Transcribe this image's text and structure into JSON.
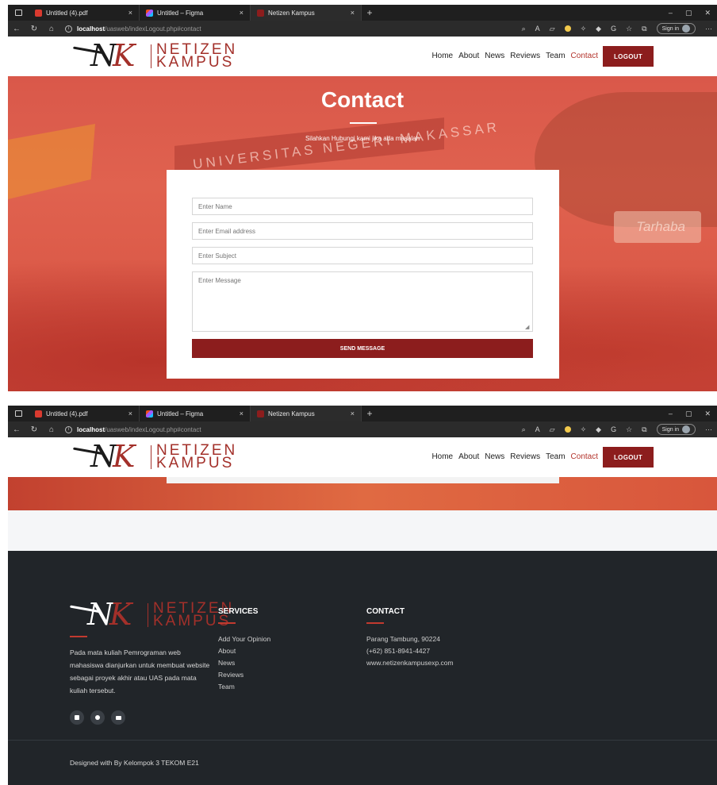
{
  "browser": {
    "tabs": [
      {
        "title": "Untitled (4).pdf",
        "close": "×",
        "favicon": "pdf-icon"
      },
      {
        "title": "Untitled – Figma",
        "close": "×",
        "favicon": "figma-icon"
      },
      {
        "title": "Netizen Kampus",
        "close": "×",
        "favicon": "netizen-icon"
      }
    ],
    "new_tab": "+",
    "address_host": "localhost",
    "address_path": "/uasweb/indexLogout.php#contact",
    "sign_in": "Sign in",
    "window_controls": [
      "–",
      "▢",
      "✕"
    ]
  },
  "site": {
    "logo_monogram_n": "N",
    "logo_monogram_k": "K",
    "logo_line1": "NETIZEN",
    "logo_line2": "KAMPUS",
    "nav": [
      "Home",
      "About",
      "News",
      "Reviews",
      "Team",
      "Contact"
    ],
    "active_nav": "Contact",
    "logout": "LOGOUT"
  },
  "hero": {
    "title": "Contact",
    "subtitle": "Silahkan Hubungi kami jika ada masalah",
    "gate_text": "UNIVERSITAS NEGERI MAKASSAR",
    "banner_text": "Tarhaba"
  },
  "form": {
    "name_placeholder": "Enter Name",
    "email_placeholder": "Enter Email address",
    "subject_placeholder": "Enter Subject",
    "message_placeholder": "Enter Message",
    "submit": "SEND MESSAGE"
  },
  "footer": {
    "description": "Pada mata kuliah Pemrograman web mahasiswa dianjurkan untuk membuat website sebagai proyek akhir atau UAS pada mata kuliah tersebut.",
    "services_title": "SERVICES",
    "services": [
      "Add Your Opinion",
      "About",
      "News",
      "Reviews",
      "Team"
    ],
    "contact_title": "CONTACT",
    "contact": [
      "Parang Tambung, 90224",
      "(+62) 851-8941-4427",
      "www.netizenkampusexp.com"
    ],
    "socials": [
      "twitter-icon",
      "instagram-icon",
      "youtube-icon"
    ],
    "credit": "Designed with By Kelompok 3 TEKOM E21"
  },
  "colors": {
    "brand": "#8c1d1d",
    "accent": "#b3332b",
    "footer_bg": "#212529"
  }
}
